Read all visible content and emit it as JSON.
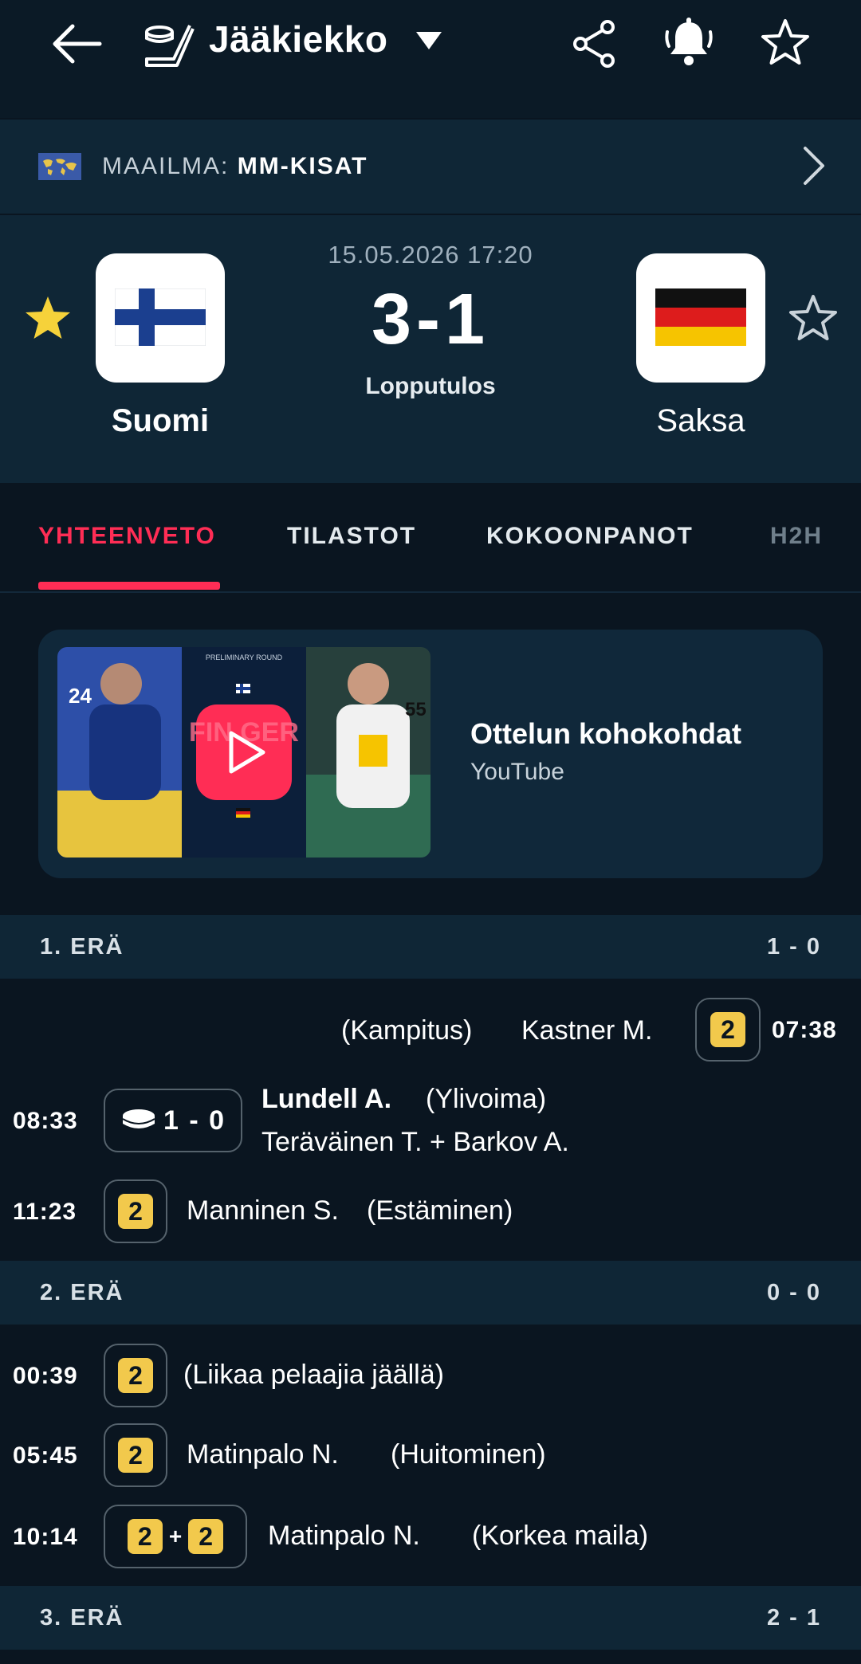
{
  "header": {
    "title": "Jääkiekko",
    "icons": [
      "back-arrow-icon",
      "hockey-stick-icon",
      "dropdown-caret-icon",
      "share-icon",
      "bell-icon",
      "star-outline-icon"
    ]
  },
  "competition": {
    "region": "MAAILMA:",
    "name": "MM-KISAT"
  },
  "match": {
    "datetime": "15.05.2026 17:20",
    "score": "3-1",
    "status": "Lopputulos",
    "home": {
      "name": "Suomi",
      "favorite": true
    },
    "away": {
      "name": "Saksa",
      "favorite": false
    }
  },
  "tabs": [
    {
      "label": "YHTEENVETO",
      "active": true
    },
    {
      "label": "TILASTOT",
      "active": false
    },
    {
      "label": "KOKOONPANOT",
      "active": false
    },
    {
      "label": "H2H",
      "active": false
    }
  ],
  "highlights": {
    "title": "Ottelun kohokohdat",
    "source": "YouTube",
    "thumb_caption": "PRELIMINARY ROUND",
    "thumb_text": "FIN GER"
  },
  "periods": [
    {
      "label": "1. ERÄ",
      "score": "1 - 0",
      "events": [
        {
          "side": "away",
          "time": "07:38",
          "penalty": "2",
          "player": "Kastner M.",
          "reason": "(Kampitus)"
        },
        {
          "side": "home",
          "time": "08:33",
          "type": "goal",
          "score": "1 - 0",
          "scorer": "Lundell A.",
          "note": "(Ylivoima)",
          "assists": "Teräväinen T. + Barkov A."
        },
        {
          "side": "home",
          "time": "11:23",
          "penalty": "2",
          "player": "Manninen S.",
          "reason": "(Estäminen)"
        }
      ]
    },
    {
      "label": "2. ERÄ",
      "score": "0 - 0",
      "events": [
        {
          "side": "home",
          "time": "00:39",
          "penalty": "2",
          "reason": "(Liikaa pelaajia jäällä)"
        },
        {
          "side": "home",
          "time": "05:45",
          "penalty": "2",
          "player": "Matinpalo N.",
          "reason": "(Huitominen)"
        },
        {
          "side": "home",
          "time": "10:14",
          "penalty": "2",
          "penalty2": "2",
          "plus": "+",
          "player": "Matinpalo N.",
          "reason": "(Korkea maila)"
        }
      ]
    },
    {
      "label": "3. ERÄ",
      "score": "2 - 1"
    }
  ],
  "colors": {
    "background": "#0a1520",
    "panel": "#0f2636",
    "accent": "#ff2d55",
    "penalty": "#f2c94c",
    "favorite": "#f6d23a"
  }
}
